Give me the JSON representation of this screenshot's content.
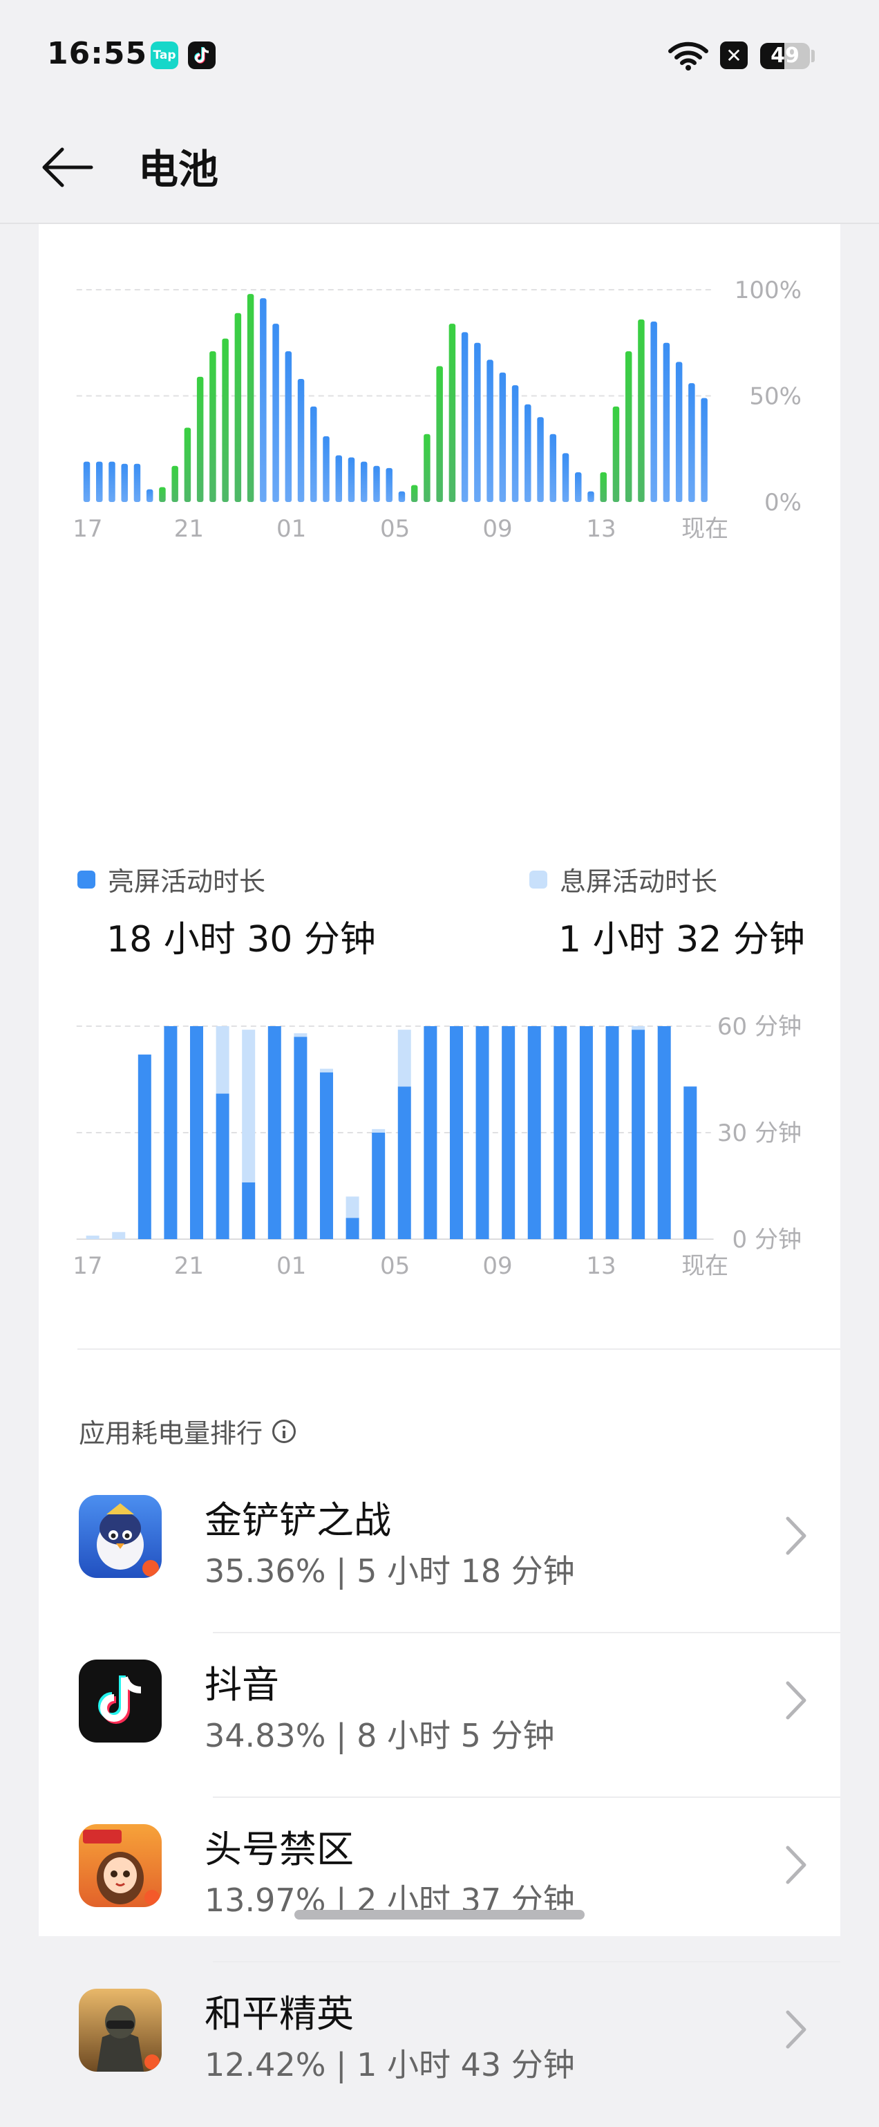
{
  "status_bar": {
    "time": "16:55",
    "tap_label": "Tap",
    "battery_level": "49",
    "battery_fraction": 0.49,
    "icons": [
      "tap-app-icon",
      "tiktok-icon",
      "wifi-icon",
      "x-app-icon",
      "battery-icon"
    ]
  },
  "header": {
    "title": "电池",
    "back_icon": "arrow-left-icon"
  },
  "colors": {
    "accent": "#3a8ef3",
    "green": "#3ccd4b",
    "blue_bar": "#3a8ef3",
    "light_blue": "#c8e0fb",
    "axis_text": "#b0b0b3"
  },
  "chart_data": [
    {
      "type": "bar",
      "title": "",
      "ylabel_ticks": [
        "100%",
        "50%",
        "0%"
      ],
      "ylim": [
        0,
        100
      ],
      "x_tick_labels": [
        "17",
        "21",
        "01",
        "05",
        "09",
        "13",
        "现在"
      ],
      "grid": true,
      "values": [
        19,
        19,
        19,
        18,
        18,
        6,
        7,
        17,
        35,
        59,
        71,
        77,
        89,
        98,
        96,
        84,
        71,
        58,
        45,
        31,
        22,
        21,
        19,
        17,
        16,
        5,
        8,
        32,
        64,
        84,
        80,
        75,
        67,
        61,
        55,
        46,
        40,
        32,
        23,
        14,
        5,
        14,
        45,
        71,
        86,
        85,
        75,
        66,
        56,
        49
      ],
      "series_colors": [
        "#3ccd4b",
        "#3a8ef3"
      ],
      "charging_flags": [
        0,
        0,
        0,
        0,
        0,
        0,
        1,
        1,
        1,
        1,
        1,
        1,
        1,
        1,
        0,
        0,
        0,
        0,
        0,
        0,
        0,
        0,
        0,
        0,
        0,
        0,
        1,
        1,
        1,
        1,
        0,
        0,
        0,
        0,
        0,
        0,
        0,
        0,
        0,
        0,
        0,
        1,
        1,
        1,
        1,
        0,
        0,
        0,
        0,
        0
      ]
    },
    {
      "type": "bar",
      "title": "",
      "ylabel_ticks": [
        "60 分钟",
        "30 分钟",
        "0 分钟"
      ],
      "ylim": [
        0,
        60
      ],
      "x_tick_labels": [
        "17",
        "21",
        "01",
        "05",
        "09",
        "13",
        "现在"
      ],
      "grid": true,
      "series": [
        {
          "name": "亮屏活动时长",
          "values": [
            0,
            0,
            52,
            60,
            60,
            41,
            16,
            60,
            57,
            47,
            6,
            30,
            43,
            60,
            60,
            60,
            60,
            60,
            60,
            60,
            60,
            59,
            60,
            43
          ]
        },
        {
          "name": "息屏活动时长",
          "values": [
            1,
            2,
            0,
            0,
            0,
            19,
            43,
            0,
            1,
            1,
            6,
            1,
            16,
            0,
            0,
            0,
            0,
            0,
            0,
            0,
            0,
            1,
            0,
            0
          ]
        }
      ]
    }
  ],
  "usage": {
    "screen_on": {
      "label": "亮屏活动时长",
      "value": "18 小时 30 分钟"
    },
    "screen_off": {
      "label": "息屏活动时长",
      "value": "1 小时 32 分钟"
    }
  },
  "ranking": {
    "title": "应用耗电量排行",
    "info_icon": "info-icon",
    "apps": [
      {
        "name": "金铲铲之战",
        "stats": "35.36% | 5 小时 18 分钟"
      },
      {
        "name": "抖音",
        "stats": "34.83% | 8 小时 5 分钟"
      },
      {
        "name": "头号禁区",
        "stats": "13.97% | 2 小时 37 分钟"
      },
      {
        "name": "和平精英",
        "stats": "12.42% | 1 小时 43 分钟"
      }
    ]
  }
}
